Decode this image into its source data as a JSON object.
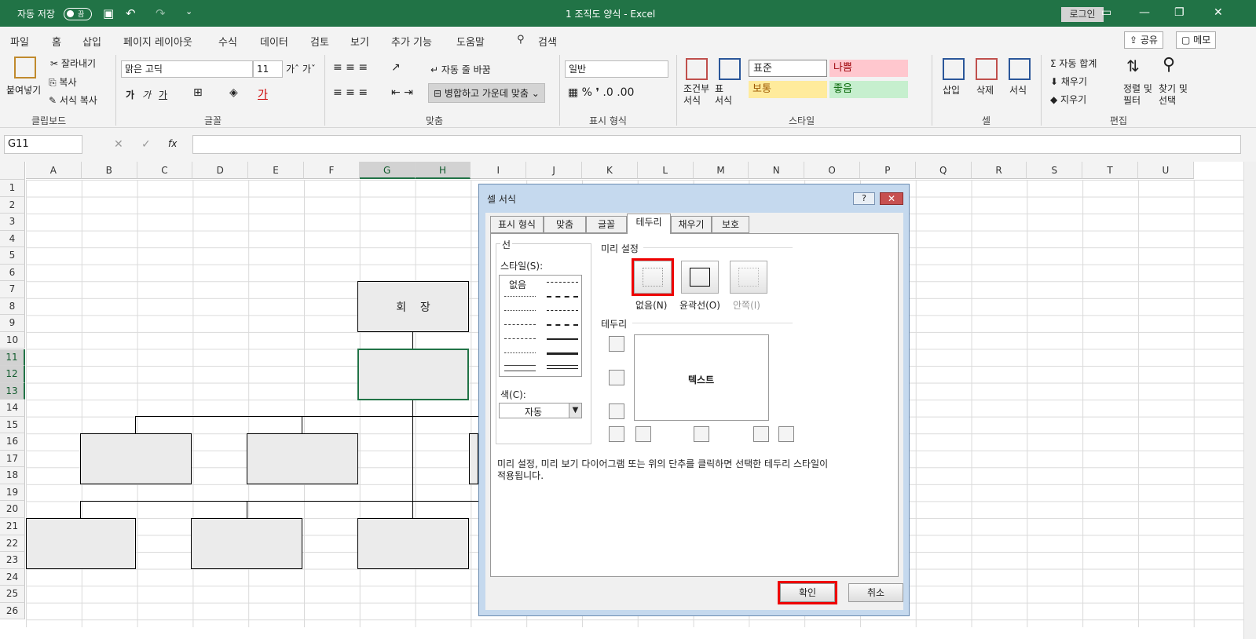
{
  "titlebar": {
    "autosave": "자동 저장",
    "toggle": "끔",
    "title": "1 조직도 양식  -  Excel",
    "login": "로그인"
  },
  "menu": {
    "tabs": [
      "파일",
      "홈",
      "삽입",
      "페이지 레이아웃",
      "수식",
      "데이터",
      "검토",
      "보기",
      "추가 기능",
      "도움말",
      "검색"
    ],
    "share": "공유",
    "memo": "메모"
  },
  "ribbon": {
    "clipboard": {
      "paste": "붙여넣기",
      "cut": "잘라내기",
      "copy": "복사",
      "format_painter": "서식 복사",
      "group": "클립보드"
    },
    "font": {
      "name": "맑은 고딕",
      "size": "11",
      "group": "글꼴",
      "bold": "가",
      "italic": "가",
      "underline": "가"
    },
    "align": {
      "wrap": "자동 줄 바꿈",
      "merge": "병합하고 가운데 맞춤",
      "group": "맞춤"
    },
    "number": {
      "format": "일반",
      "group": "표시 형식"
    },
    "styles": {
      "cond": "조건부\n서식",
      "table": "표\n서식",
      "normal": "표준",
      "bad": "나쁨",
      "neutral": "보통",
      "good": "좋음",
      "group": "스타일"
    },
    "cells": {
      "insert": "삽입",
      "delete": "삭제",
      "format": "서식",
      "group": "셀"
    },
    "edit": {
      "autosum": "자동 합계",
      "fill": "채우기",
      "clear": "지우기",
      "sort": "정렬 및\n필터",
      "find": "찾기 및\n선택",
      "group": "편집"
    }
  },
  "formula": {
    "namebox": "G11",
    "fx": "fx"
  },
  "sheet": {
    "columns": [
      "A",
      "B",
      "C",
      "D",
      "E",
      "F",
      "G",
      "H",
      "I",
      "J",
      "K",
      "L",
      "M",
      "N",
      "O",
      "P",
      "Q",
      "R",
      "S",
      "T",
      "U"
    ],
    "rows": [
      "1",
      "2",
      "3",
      "4",
      "5",
      "6",
      "7",
      "8",
      "9",
      "10",
      "11",
      "12",
      "13",
      "14",
      "15",
      "16",
      "17",
      "18",
      "19",
      "20",
      "21",
      "22",
      "23",
      "24",
      "25",
      "26"
    ],
    "chairman": "회    장"
  },
  "dialog": {
    "title": "셀 서식",
    "help": "?",
    "close": "✕",
    "tabs": [
      "표시 형식",
      "맞춤",
      "글꼴",
      "테두리",
      "채우기",
      "보호"
    ],
    "line_label": "선",
    "style_label": "스타일(S):",
    "none": "없음",
    "color_label": "색(C):",
    "color_value": "자동",
    "preset_label": "미리 설정",
    "presets": [
      "없음(N)",
      "윤곽선(O)",
      "안쪽(I)"
    ],
    "border_label": "테두리",
    "preview_text": "텍스트",
    "hint": "미리 설정, 미리 보기 다이어그램 또는 위의 단추를 클릭하면 선택한 테두리 스타일이\n적용됩니다.",
    "ok": "확인",
    "cancel": "취소"
  }
}
